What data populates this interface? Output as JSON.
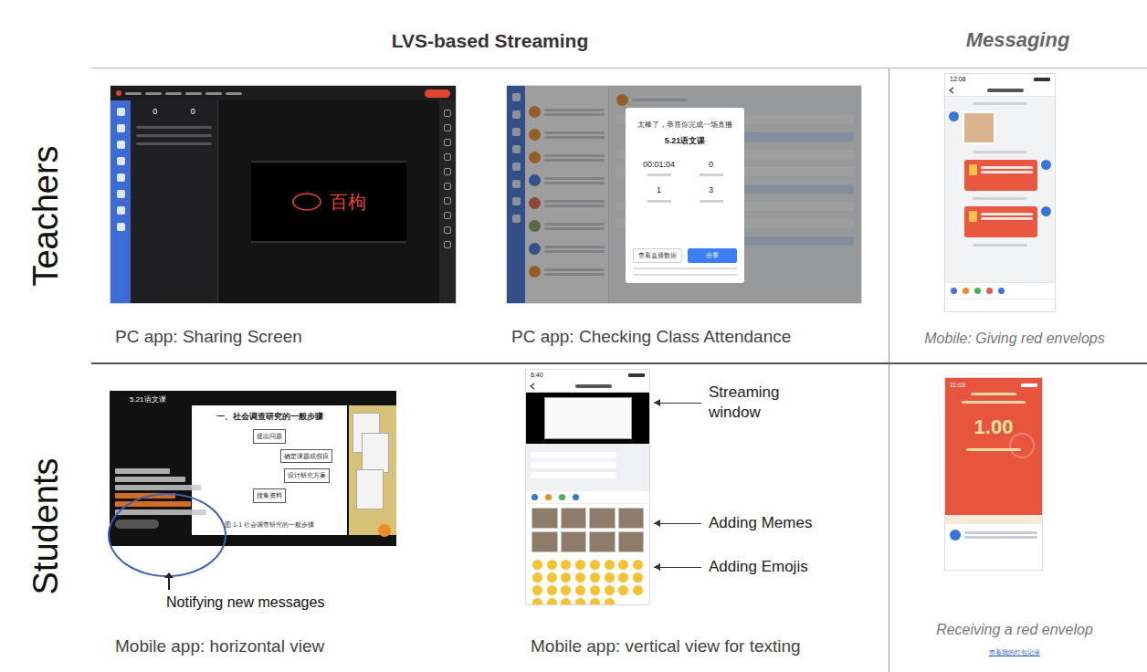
{
  "header": {
    "streaming": "LVS-based Streaming",
    "messaging": "Messaging"
  },
  "rows": [
    {
      "label": "Teachers",
      "panels": [
        {
          "kind": "pc-share",
          "caption": "PC app: Sharing Screen",
          "counters": [
            "0",
            "0"
          ],
          "handwriting": "百枸"
        },
        {
          "kind": "pc-attendance",
          "caption": "PC app: Checking Class Attendance",
          "modal": {
            "title": "太棒了，恭喜你完成一场直播",
            "course": "5.21语文课",
            "stats": [
              "00:01:04",
              "0",
              "1",
              "3"
            ],
            "buttons": [
              {
                "label": "查看直播数据",
                "primary": false
              },
              {
                "label": "分享",
                "primary": true
              }
            ]
          }
        },
        {
          "kind": "mobile-chat",
          "caption": "Mobile: Giving red envelops",
          "time": "12:08"
        }
      ]
    },
    {
      "label": "Students",
      "panels": [
        {
          "kind": "mobile-horizontal",
          "caption": "Mobile app: horizontal view",
          "title": "5.21语文课",
          "slide": {
            "heading": "一、社会调查研究的一般步骤",
            "steps": [
              "提出问题",
              "确定课题或假设",
              "设计研究方案",
              "搜集资料"
            ],
            "figure": "图 1-1 社会调查研究的一般步骤"
          },
          "annotation": "Notifying new messages"
        },
        {
          "kind": "mobile-vertical",
          "caption": "Mobile app: vertical view for texting",
          "time": "6:40",
          "annotations": [
            "Streaming window",
            "Adding Memes",
            "Adding Emojis"
          ]
        },
        {
          "kind": "mobile-envelope",
          "caption": "Receiving a red envelop",
          "time": "11:03",
          "amount": "1.00",
          "footer_link": "查看我的红包记录"
        }
      ]
    }
  ]
}
